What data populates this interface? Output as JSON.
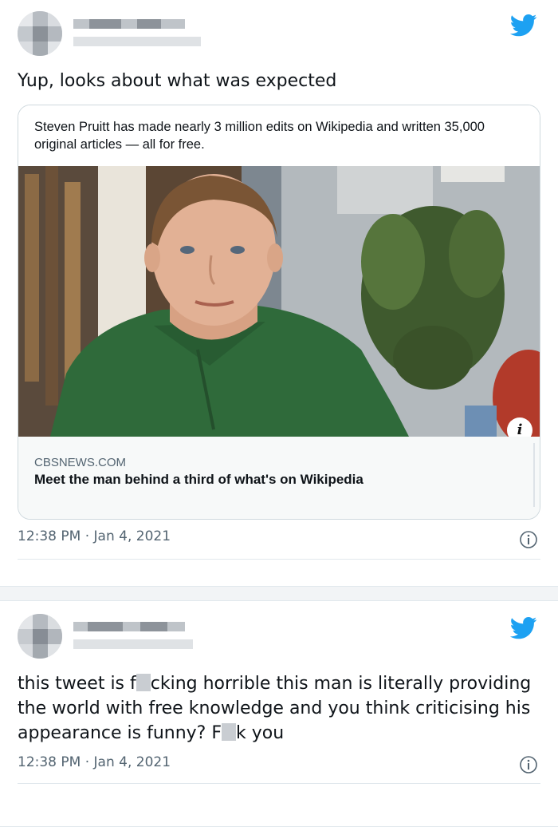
{
  "colors": {
    "accent": "#1da1f2",
    "text": "#0f1419",
    "muted": "#536471"
  },
  "tweets": [
    {
      "text": "Yup, looks about what was expected",
      "card": {
        "description": "Steven Pruitt has made nearly 3 million edits on Wikipedia and written 35,000 original articles — all for free.",
        "domain": "CBSNEWS.COM",
        "title": "Meet the man behind a third of what's on Wikipedia",
        "image_badge": "i"
      },
      "time": "12:38 PM",
      "sep": "·",
      "date": "Jan 4, 2021"
    },
    {
      "text_parts": [
        "this tweet is f",
        "cking horrible this man is literally providing the world with free knowledge and you think criticising his appearance is funny? F",
        "k you"
      ],
      "time": "12:38 PM",
      "sep": "·",
      "date": "Jan 4, 2021"
    }
  ],
  "icons": [
    "twitter-bird-icon",
    "info-icon"
  ]
}
